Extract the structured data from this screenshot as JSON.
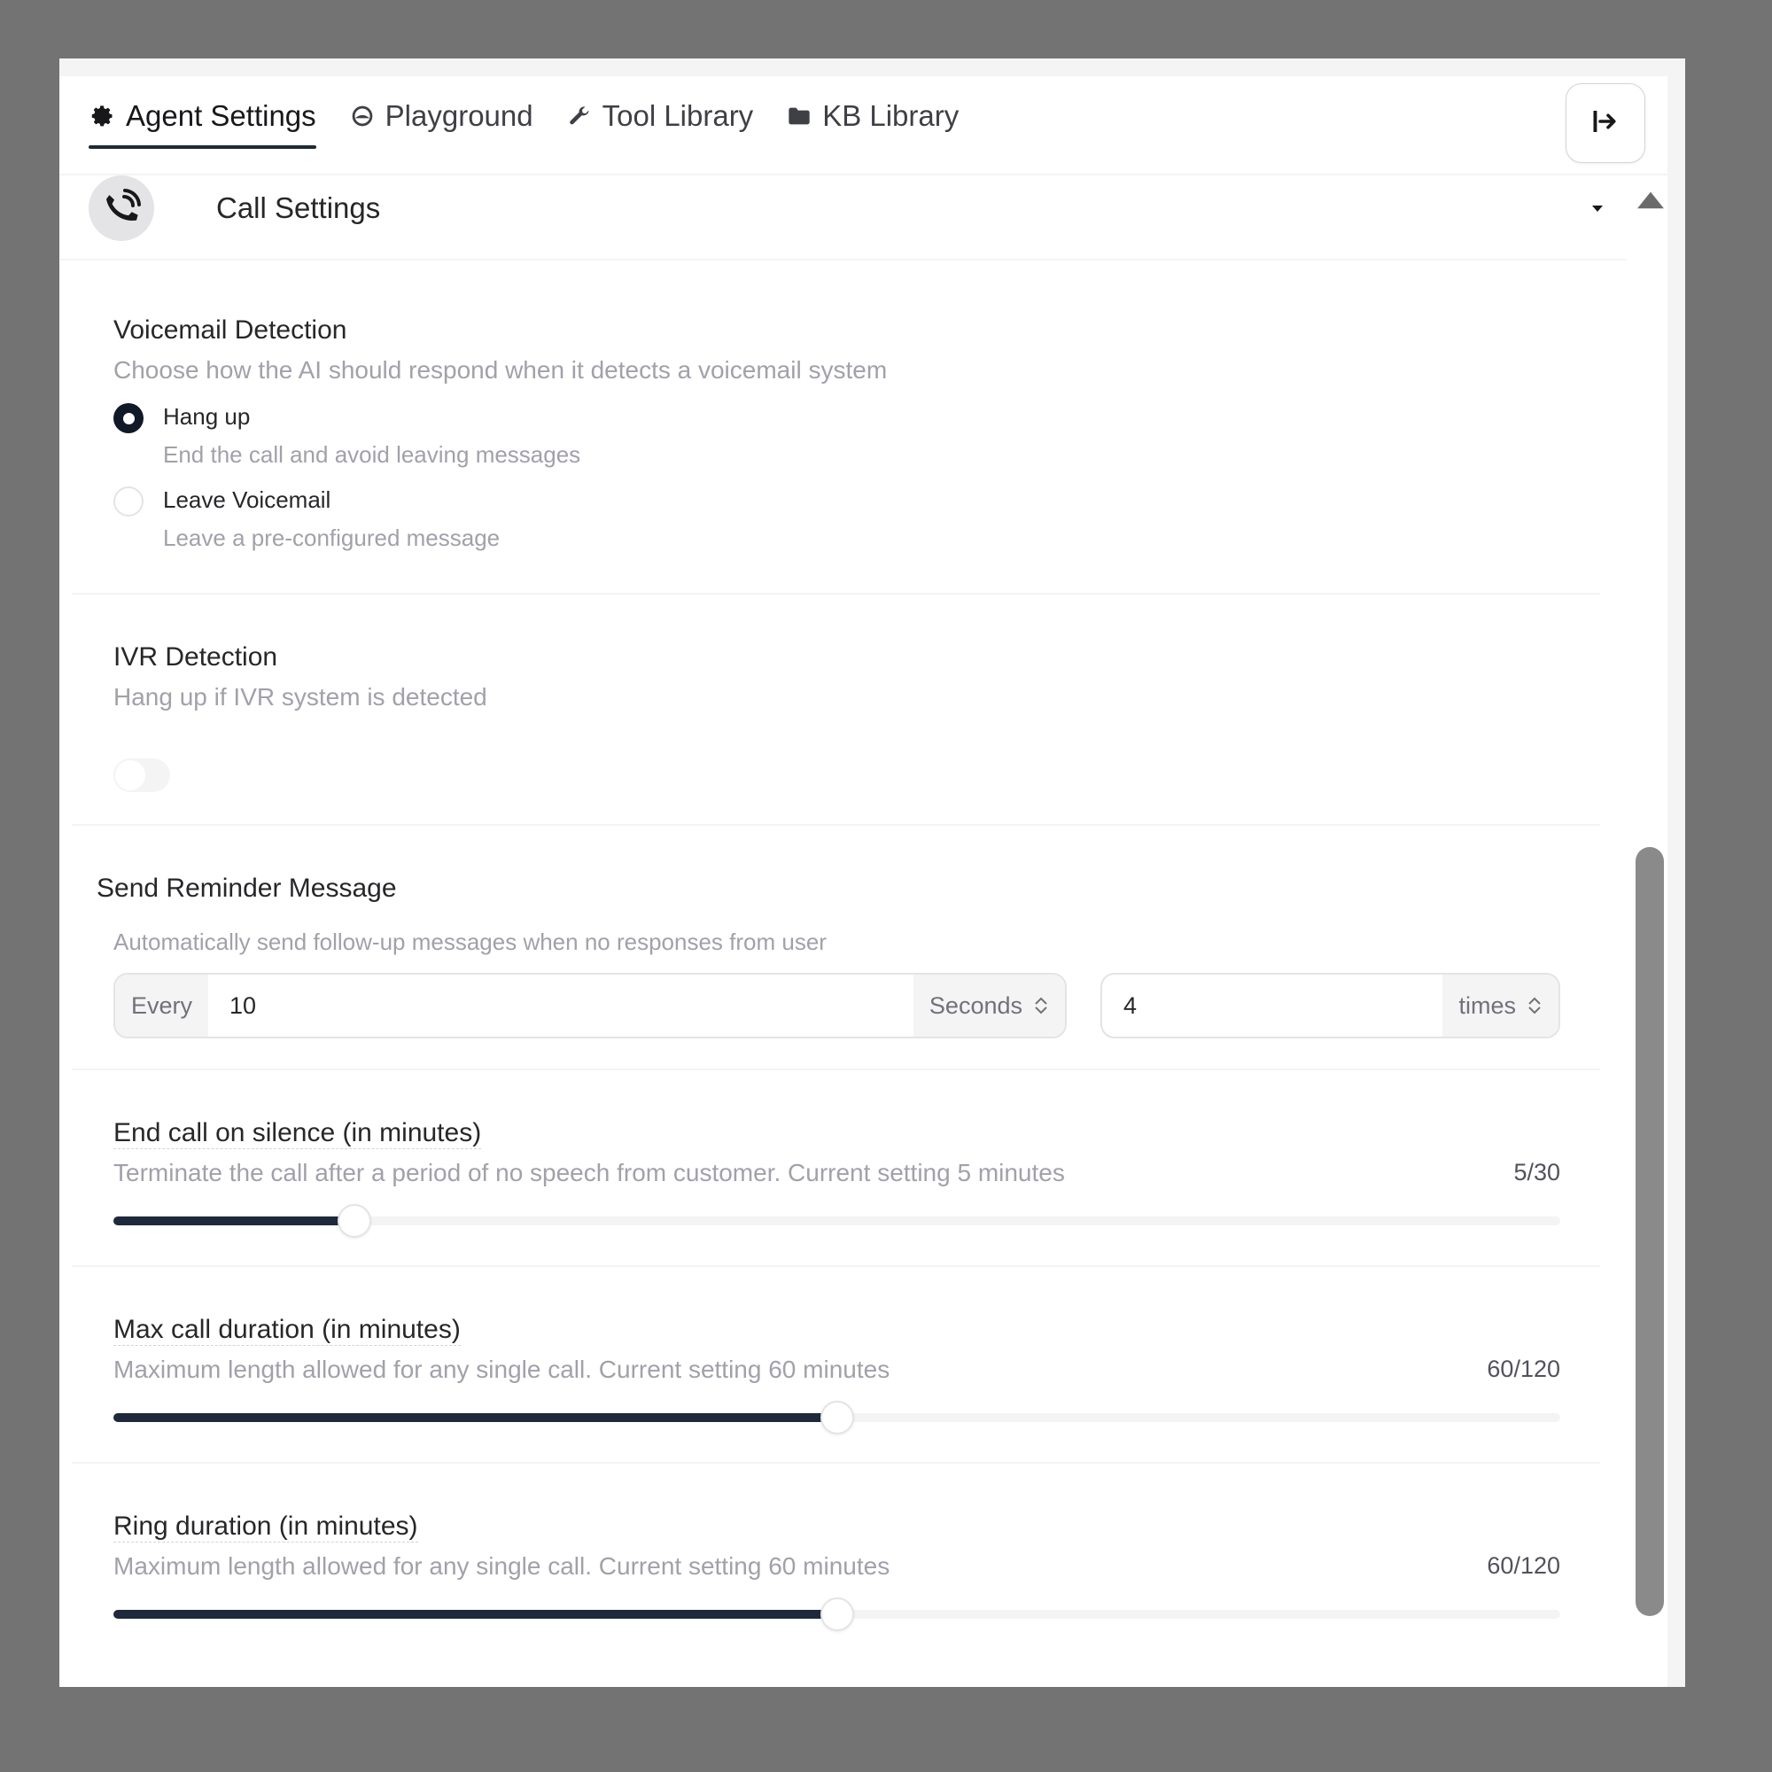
{
  "tabs": [
    {
      "label": "Agent Settings",
      "icon": "gear-icon",
      "active": true
    },
    {
      "label": "Playground",
      "icon": "playground-icon",
      "active": false
    },
    {
      "label": "Tool Library",
      "icon": "wrench-icon",
      "active": false
    },
    {
      "label": "KB Library",
      "icon": "folder-icon",
      "active": false
    }
  ],
  "header_action_icon": "exit-to-right-icon",
  "section": {
    "title": "Call Settings",
    "icon": "phone-call-icon",
    "chevron": "caret-down-icon"
  },
  "voicemail": {
    "title": "Voicemail Detection",
    "description": "Choose how the AI should respond when it detects a voicemail system",
    "options": [
      {
        "label": "Hang up",
        "sub": "End the call and avoid leaving messages",
        "selected": true
      },
      {
        "label": "Leave Voicemail",
        "sub": "Leave a pre-configured message",
        "selected": false
      }
    ]
  },
  "ivr": {
    "title": "IVR Detection",
    "description": "Hang up if IVR system is detected",
    "enabled": false
  },
  "reminder": {
    "title": "Send Reminder Message",
    "description": "Automatically send follow-up messages when no responses from user",
    "prefix": "Every",
    "interval_value": "10",
    "interval_unit": "Seconds",
    "count_value": "4",
    "count_unit": "times"
  },
  "sliders": [
    {
      "title": "End call on silence (in minutes)",
      "description": "Terminate the call after a period of no speech from customer. Current setting 5 minutes",
      "counter": "5/30",
      "value": 5,
      "max": 30
    },
    {
      "title": "Max call duration (in minutes)",
      "description": "Maximum length allowed for any single call. Current setting 60 minutes",
      "counter": "60/120",
      "value": 60,
      "max": 120
    },
    {
      "title": "Ring duration (in minutes)",
      "description": "Maximum length allowed for any single call. Current setting 60 minutes",
      "counter": "60/120",
      "value": 60,
      "max": 120
    }
  ],
  "colors": {
    "background": "#737373",
    "accent": "#1e293b",
    "muted_text": "#a1a1aa"
  }
}
